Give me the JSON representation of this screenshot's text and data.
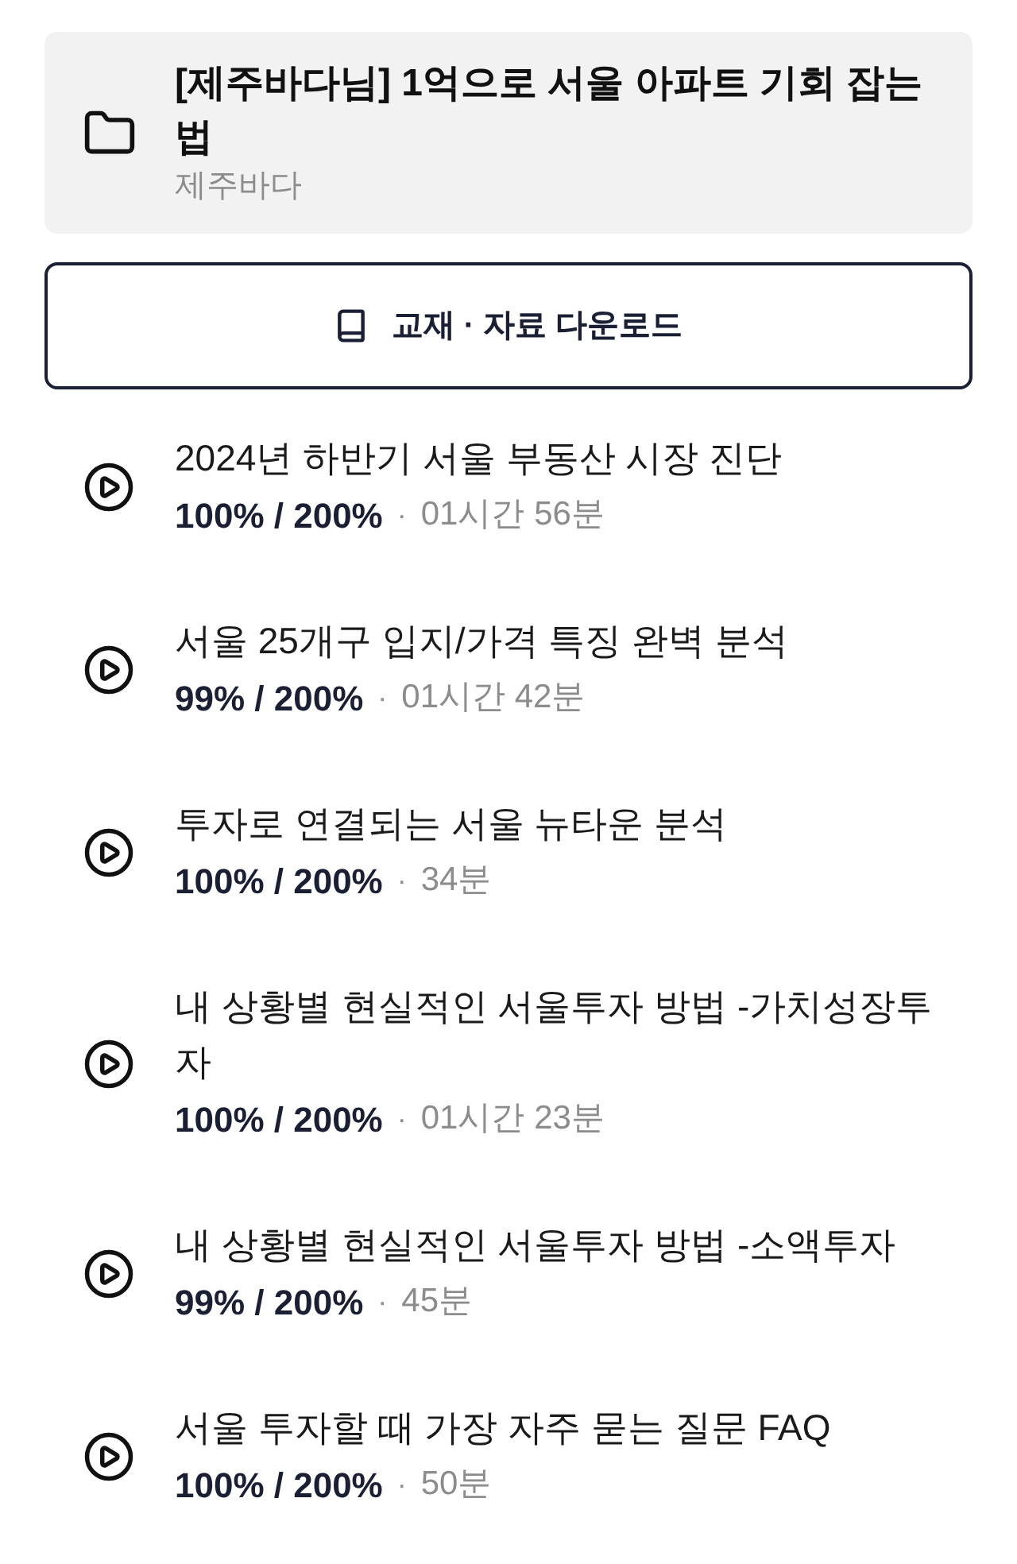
{
  "header": {
    "title": "[제주바다님] 1억으로 서울 아파트 기회 잡는 법",
    "instructor": "제주바다"
  },
  "download_button": {
    "label": "교재 · 자료 다운로드"
  },
  "lessons": [
    {
      "title": "2024년 하반기 서울 부동산 시장 진단",
      "progress": "100% / 200%",
      "separator": "·",
      "duration": "01시간 56분"
    },
    {
      "title": "서울 25개구 입지/가격 특징 완벽 분석",
      "progress": "99% / 200%",
      "separator": "·",
      "duration": "01시간 42분"
    },
    {
      "title": "투자로 연결되는 서울 뉴타운 분석",
      "progress": "100% / 200%",
      "separator": "·",
      "duration": "34분"
    },
    {
      "title": "내 상황별 현실적인 서울투자 방법 -가치성장투자",
      "progress": "100% / 200%",
      "separator": "·",
      "duration": "01시간 23분"
    },
    {
      "title": "내 상황별 현실적인 서울투자 방법 -소액투자",
      "progress": "99% / 200%",
      "separator": "·",
      "duration": "45분"
    },
    {
      "title": "서울 투자할 때 가장 자주 묻는 질문 FAQ",
      "progress": "100% / 200%",
      "separator": "·",
      "duration": "50분"
    }
  ]
}
